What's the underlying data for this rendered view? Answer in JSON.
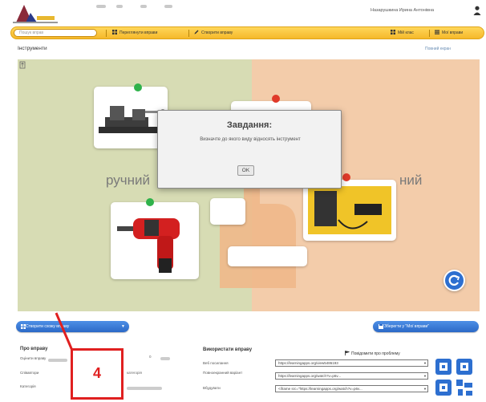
{
  "header": {
    "user_name": "Назарушкина Ирина Антонівна",
    "user_icon": "user-icon"
  },
  "toolbar": {
    "search_placeholder": "Пошук вправ",
    "nav_items": [
      {
        "label": "Переглянути вправи",
        "icon": "grid-icon"
      },
      {
        "label": "Створити вправу",
        "icon": "pencil-icon"
      },
      {
        "label": "Мій клас",
        "icon": "grid-icon"
      },
      {
        "label": "Мої вправи",
        "icon": "list-icon"
      }
    ]
  },
  "page": {
    "title": "Інструменти",
    "fullscreen_link": "Повний екран"
  },
  "game": {
    "left_label": "ручний",
    "right_label": "ний",
    "dot_colors": {
      "green": "#2fb24b",
      "red": "#e03a2a"
    }
  },
  "dialog": {
    "title": "Завдання:",
    "text": "Визначте до якого виду відносять інструмент",
    "ok_label": "OK"
  },
  "actions": {
    "create_label": "Створити схожу вправу",
    "save_label": "Зберегти у \"Мої вправи\""
  },
  "about": {
    "title": "Про вправу",
    "rows": [
      "Оцінити вправу",
      "Співавтори",
      "Категорія"
    ],
    "rating_value": "0",
    "extra_label": "категорія"
  },
  "usage": {
    "title": "Використати вправу",
    "link_label": "Веб посилання",
    "embed_label": "Повноекранний варіант",
    "code_label": "Вбудувати",
    "problem_label": "Повідомити про проблему",
    "urls": [
      "https://learningapps.org/view5486193",
      "https://learningapps.org/watch?v=p6v...",
      "<iframe src=\"https://learningapps.org/watch?v=p6v..."
    ]
  },
  "annotation": {
    "number": "4",
    "color": "#e02020"
  }
}
